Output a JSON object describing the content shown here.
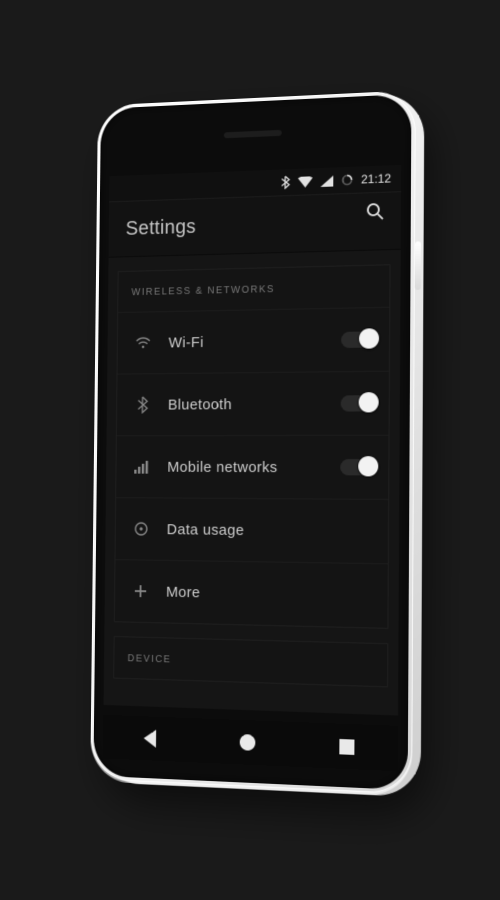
{
  "statusbar": {
    "time": "21:12"
  },
  "appbar": {
    "title": "Settings"
  },
  "sections": {
    "wireless": {
      "header": "WIRELESS & NETWORKS",
      "items": {
        "wifi": {
          "label": "Wi-Fi"
        },
        "bluetooth": {
          "label": "Bluetooth"
        },
        "mobile": {
          "label": "Mobile networks"
        },
        "data": {
          "label": "Data usage"
        },
        "more": {
          "label": "More"
        }
      }
    },
    "device": {
      "header": "DEVICE"
    }
  }
}
